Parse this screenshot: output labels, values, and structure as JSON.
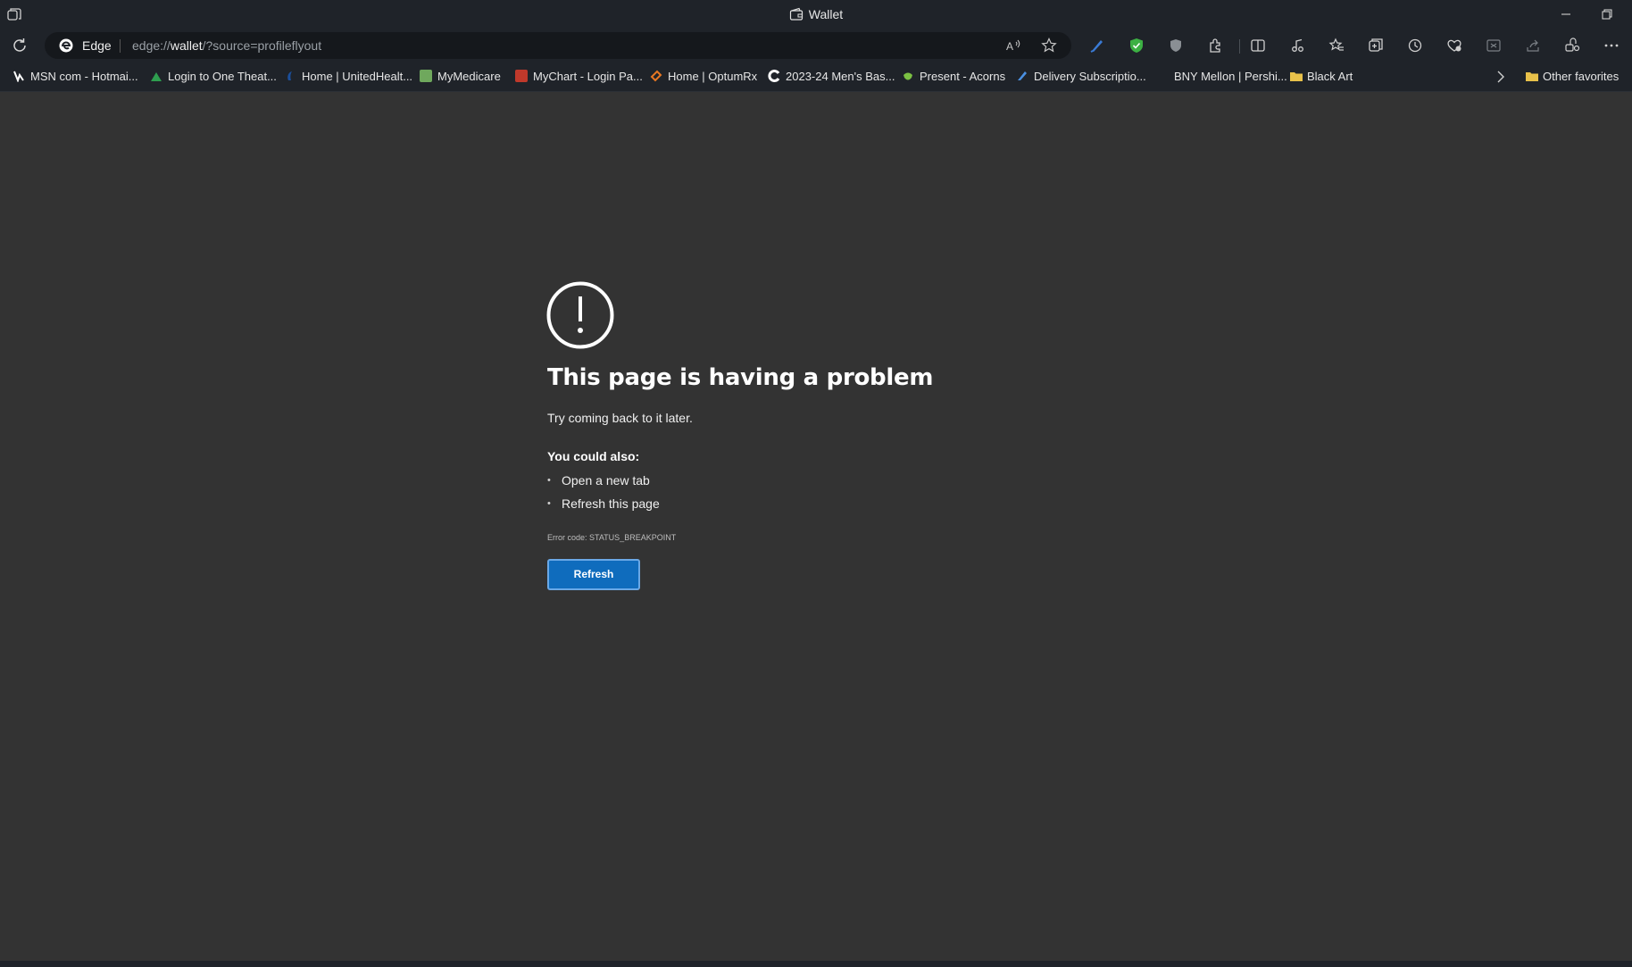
{
  "window": {
    "title": "Wallet"
  },
  "addressbar": {
    "site_name": "Edge",
    "url_prefix": "edge://",
    "url_host": "wallet",
    "url_rest": "/?source=profileflyout"
  },
  "favorites": [
    {
      "label": "MSN com - Hotmai...",
      "icon": "msn-icon",
      "color": "#ffffff"
    },
    {
      "label": "Login to One Theat...",
      "icon": "one-theater-icon",
      "color": "#2e9e4f"
    },
    {
      "label": "Home | UnitedHealt...",
      "icon": "unitedhealth-icon",
      "color": "#1b4f9c"
    },
    {
      "label": "MyMedicare",
      "icon": "medicare-icon",
      "color": "#6fa85d"
    },
    {
      "label": "MyChart - Login Pa...",
      "icon": "mychart-icon",
      "color": "#c0392b"
    },
    {
      "label": "Home | OptumRx",
      "icon": "optum-icon",
      "color": "#e87722"
    },
    {
      "label": "2023-24 Men's Bas...",
      "icon": "c-logo-icon",
      "color": "#ffffff"
    },
    {
      "label": "Present - Acorns",
      "icon": "acorns-icon",
      "color": "#7bc043"
    },
    {
      "label": "Delivery Subscriptio...",
      "icon": "delivery-icon",
      "color": "#4a90e2"
    },
    {
      "label": "BNY Mellon | Pershi...",
      "icon": "bny-icon",
      "color": "#1f2329"
    },
    {
      "label": "Black Art",
      "icon": "folder-icon",
      "color": "#e8c14a"
    }
  ],
  "other_favorites": "Other favorites",
  "error": {
    "title": "This page is having a problem",
    "subtitle": "Try coming back to it later.",
    "also_heading": "You could also:",
    "suggestions": [
      "Open a new tab",
      "Refresh this page"
    ],
    "code": "Error code: STATUS_BREAKPOINT",
    "button_label": "Refresh"
  },
  "colors": {
    "chrome": "#1f2329",
    "content_bg": "#333333",
    "button_bg": "#0f6cbd",
    "shield_green": "#3cb043",
    "pen_blue": "#3a7bd5"
  }
}
